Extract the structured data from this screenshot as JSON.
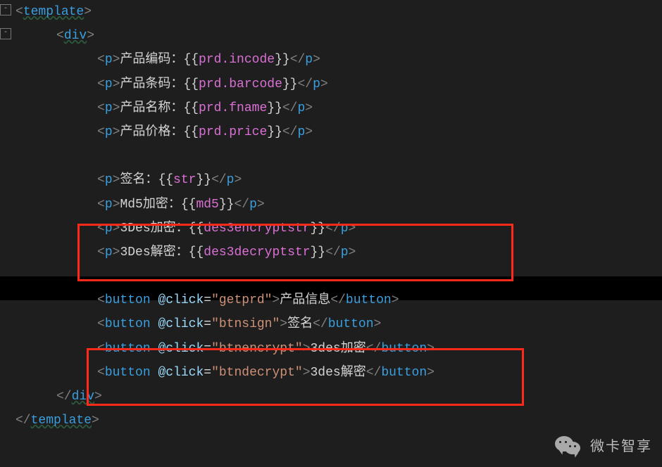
{
  "tags": {
    "template": "template",
    "div": "div",
    "p": "p",
    "button": "button"
  },
  "attr": {
    "click": "@click"
  },
  "labels": {
    "prd_code": "产品编码：",
    "prd_barcode": "产品条码：",
    "prd_name": "产品名称：",
    "prd_price": "产品价格：",
    "sign": "签名：",
    "md5": "Md5加密：",
    "des3enc": "3Des加密：",
    "des3dec": "3Des解密："
  },
  "expr": {
    "open": "{{",
    "close": "}}",
    "prd_incode": "prd.incode",
    "prd_barcode": "prd.barcode",
    "prd_fname": "prd.fname",
    "prd_price": "prd.price",
    "str": "str",
    "md5": "md5",
    "des3encryptstr": "des3encryptstr",
    "des3decryptstr": "des3decryptstr"
  },
  "buttons": {
    "getprd_method": "\"getprd\"",
    "getprd_label": "产品信息",
    "btnsign_method": "\"btnsign\"",
    "btnsign_label": "签名",
    "btnencrypt_method": "\"btnencrypt\"",
    "btnencrypt_label": "3des加密",
    "btndecrypt_method": "\"btndecrypt\"",
    "btndecrypt_label": "3des解密"
  },
  "watermark": "微卡智享"
}
